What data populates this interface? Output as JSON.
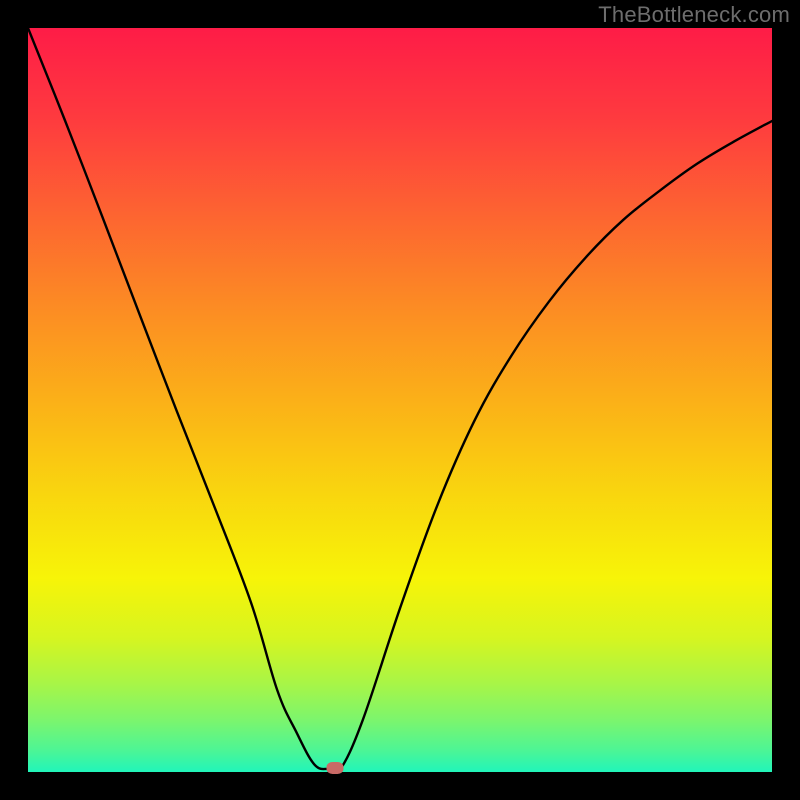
{
  "watermark": "TheBottleneck.com",
  "chart_data": {
    "type": "line",
    "title": "",
    "xlabel": "",
    "ylabel": "",
    "xlim": [
      0,
      1
    ],
    "ylim": [
      0,
      1
    ],
    "grid": false,
    "legend": false,
    "series": [
      {
        "name": "bottleneck-curve",
        "x": [
          0.0,
          0.05,
          0.1,
          0.15,
          0.2,
          0.25,
          0.3,
          0.335,
          0.36,
          0.385,
          0.405,
          0.42,
          0.45,
          0.5,
          0.55,
          0.6,
          0.65,
          0.7,
          0.75,
          0.8,
          0.85,
          0.9,
          0.95,
          1.0
        ],
        "y": [
          1.0,
          0.875,
          0.746,
          0.615,
          0.485,
          0.358,
          0.227,
          0.11,
          0.055,
          0.01,
          0.004,
          0.004,
          0.07,
          0.22,
          0.358,
          0.472,
          0.56,
          0.632,
          0.692,
          0.742,
          0.782,
          0.818,
          0.848,
          0.875
        ]
      }
    ],
    "marker": {
      "name": "current-point",
      "x": 0.412,
      "y": 0.005,
      "color": "#c96a66"
    },
    "background": {
      "type": "vertical-gradient",
      "stops": [
        {
          "pos": 0.0,
          "color": "#fe1c47"
        },
        {
          "pos": 0.25,
          "color": "#fd6431"
        },
        {
          "pos": 0.5,
          "color": "#fbb018"
        },
        {
          "pos": 0.74,
          "color": "#f7f408"
        },
        {
          "pos": 1.0,
          "color": "#21f5ba"
        }
      ]
    }
  }
}
